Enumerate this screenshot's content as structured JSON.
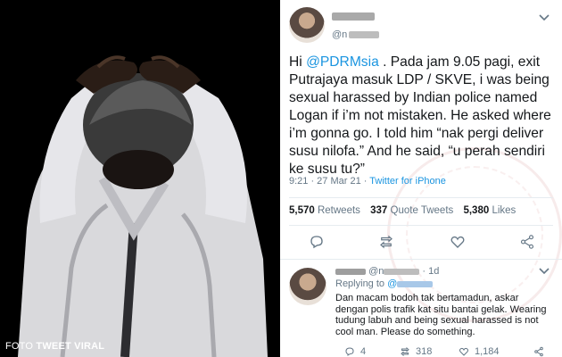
{
  "photo": {
    "credit_label": "FOTO",
    "credit_source": "TWEET VIRAL"
  },
  "tweet": {
    "handle_prefix": "@n",
    "body_prefix": "Hi ",
    "mention": "@PDRMsia",
    "body": " . Pada jam 9.05 pagi, exit Putrajaya masuk LDP / SKVE, i was being sexual harassed by Indian police named Logan if i’m not mistaken. He asked where i’m gonna go. I told him “nak pergi deliver susu nilofa.” And he said, “u perah sendiri ke susu tu?”",
    "time": "9:21 · 27 Mar 21 · ",
    "source": "Twitter for iPhone",
    "retweets_count": "5,570",
    "retweets_label": "Retweets",
    "quotes_count": "337",
    "quotes_label": "Quote Tweets",
    "likes_count": "5,380",
    "likes_label": "Likes"
  },
  "reply": {
    "handle_prefix": "@n",
    "age": "· 1d",
    "replying_label": "Replying to ",
    "replying_prefix": "@",
    "text": "Dan macam bodoh tak bertamadun, askar dengan polis trafik kat situ bantai gelak. Wearing tudung labuh and being sexual harassed is not cool man. Please do something.",
    "reply_count": "4",
    "retweet_count": "318",
    "like_count": "1,184"
  },
  "colors": {
    "link": "#1b95e0",
    "muted": "#657786",
    "text": "#14171a"
  },
  "icons": [
    "chevron-down-icon",
    "reply-icon",
    "retweet-icon",
    "like-icon",
    "share-icon"
  ]
}
